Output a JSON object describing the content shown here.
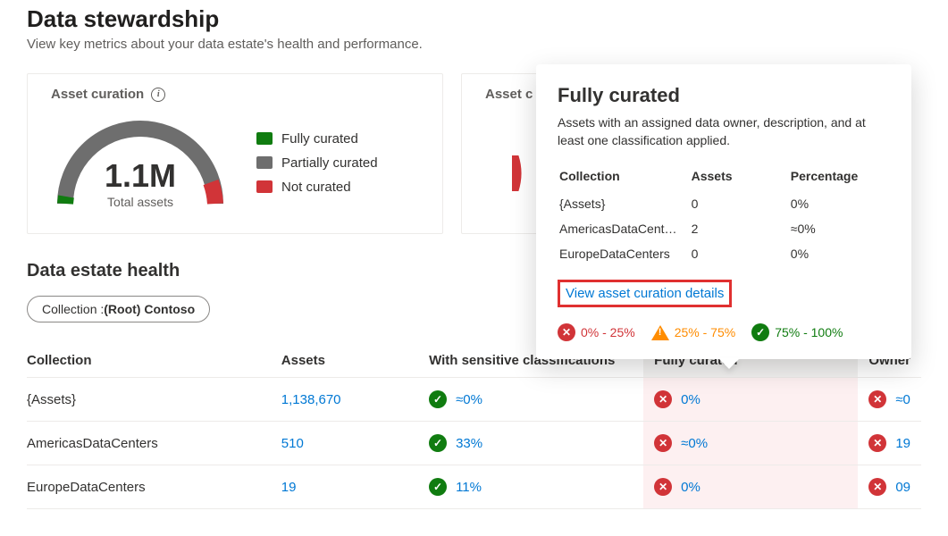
{
  "header": {
    "title": "Data stewardship",
    "subtitle": "View key metrics about your data estate's health and performance."
  },
  "cards": {
    "curation": {
      "title": "Asset curation",
      "total_value": "1.1M",
      "total_label": "Total assets",
      "legend": {
        "full": "Fully curated",
        "partial": "Partially curated",
        "none": "Not curated"
      }
    },
    "curation2": {
      "title": "Asset c"
    }
  },
  "estate": {
    "title": "Data estate health",
    "filter_prefix": "Collection : ",
    "filter_value": "(Root) Contoso",
    "columns": {
      "collection": "Collection",
      "assets": "Assets",
      "sensitive": "With sensitive classifications",
      "fully": "Fully curated",
      "owner": "Owner"
    },
    "rows": [
      {
        "collection": "{Assets}",
        "assets": "1,138,670",
        "sensitive": "≈0%",
        "sensitive_state": "ok",
        "fully": "0%",
        "fully_state": "bad",
        "owner": "≈0",
        "owner_state": "bad"
      },
      {
        "collection": "AmericasDataCenters",
        "assets": "510",
        "sensitive": "33%",
        "sensitive_state": "ok",
        "fully": "≈0%",
        "fully_state": "bad",
        "owner": "19",
        "owner_state": "bad"
      },
      {
        "collection": "EuropeDataCenters",
        "assets": "19",
        "sensitive": "11%",
        "sensitive_state": "ok",
        "fully": "0%",
        "fully_state": "bad",
        "owner": "09",
        "owner_state": "bad"
      }
    ]
  },
  "popover": {
    "title": "Fully curated",
    "desc": "Assets with an assigned data owner, description, and at least one classification applied.",
    "cols": {
      "collection": "Collection",
      "assets": "Assets",
      "percentage": "Percentage"
    },
    "rows": [
      {
        "collection": "{Assets}",
        "assets": "0",
        "percentage": "0%"
      },
      {
        "collection": "AmericasDataCent…",
        "assets": "2",
        "percentage": "≈0%"
      },
      {
        "collection": "EuropeDataCenters",
        "assets": "0",
        "percentage": "0%"
      }
    ],
    "link": "View asset curation details",
    "legend": {
      "low": "0% - 25%",
      "mid": "25% - 75%",
      "high": "75% - 100%"
    }
  },
  "chart_data": {
    "type": "pie",
    "title": "Asset curation",
    "total": "1.1M",
    "series": [
      {
        "name": "Fully curated",
        "value_pct": 1,
        "color": "#107c10"
      },
      {
        "name": "Partially curated",
        "value_pct": 92,
        "color": "#6e6e6e"
      },
      {
        "name": "Not curated",
        "value_pct": 7,
        "color": "#d13438"
      }
    ]
  }
}
